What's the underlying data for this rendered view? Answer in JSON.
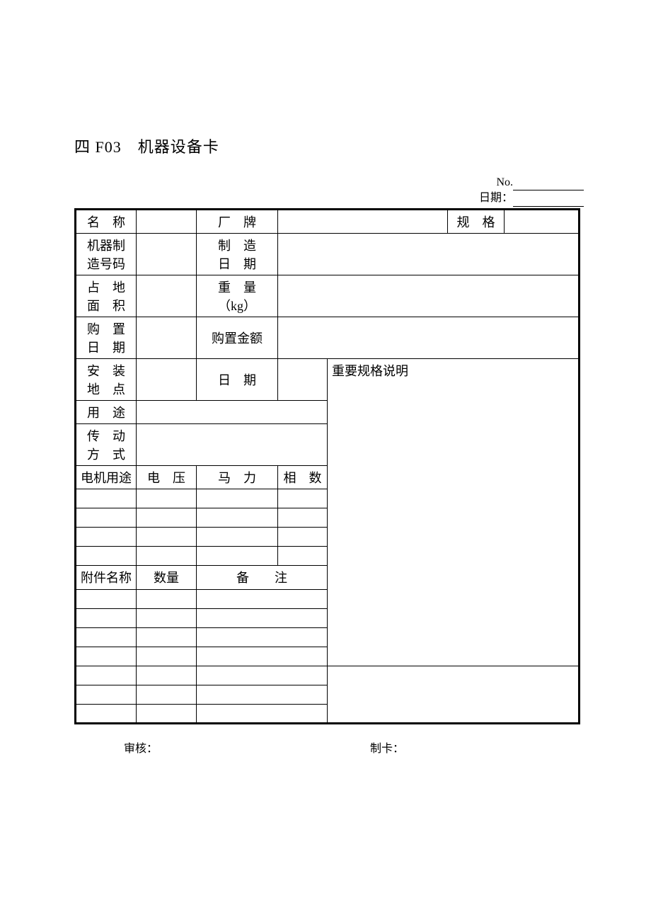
{
  "title": "四 F03　机器设备卡",
  "meta": {
    "no_label": "No.",
    "date_label": "日期："
  },
  "labels": {
    "name": "名　称",
    "brand": "厂　牌",
    "spec": "规　格",
    "machine_no": "机器制造号码",
    "mfg_date": "制　造日　期",
    "area": "占　地面　积",
    "weight": "重　量（kg）",
    "purchase_date": "购　置日　期",
    "purchase_amount": "购置金额",
    "install_loc": "安　装地　点",
    "date": "日　期",
    "important_spec": "重要规格说明",
    "usage": "用　途",
    "drive_mode": "传　动方　式",
    "motor_usage": "电机用途",
    "voltage": "电　压",
    "horsepower": "马　力",
    "phases": "相　数",
    "attachment_name": "附件名称",
    "quantity": "数量",
    "remarks": "备　　注"
  },
  "footer": {
    "reviewer": "审核：",
    "card_maker": "制卡："
  }
}
